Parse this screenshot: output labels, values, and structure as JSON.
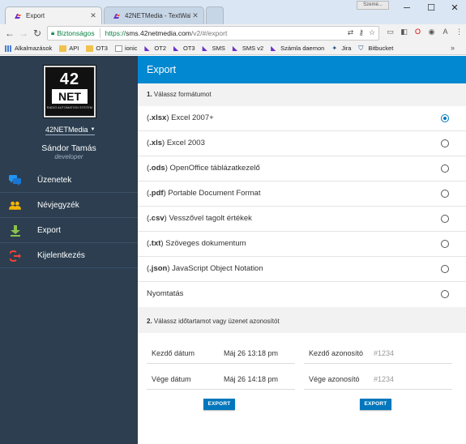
{
  "browser": {
    "tabs": [
      {
        "title": "Export",
        "active": true
      },
      {
        "title": "42NETMedia - TextWall",
        "active": false
      }
    ],
    "user_badge": "Szemé...",
    "url": {
      "secure_label": "Biztonságos",
      "scheme": "https://",
      "host": "sms.42netmedia.com",
      "path": "/v2/#/export"
    },
    "bookmarks": [
      {
        "label": "Alkalmazások",
        "icon": "apps-grid-icon"
      },
      {
        "label": "API",
        "icon": "folder-icon"
      },
      {
        "label": "OT3",
        "icon": "folder-icon"
      },
      {
        "label": "ionic",
        "icon": "page-icon"
      },
      {
        "label": "OT2",
        "icon": "42net-logo-icon"
      },
      {
        "label": "OT3",
        "icon": "42net-logo-icon"
      },
      {
        "label": "SMS",
        "icon": "42net-logo-icon"
      },
      {
        "label": "SMS v2",
        "icon": "42net-logo-icon"
      },
      {
        "label": "Számla daemon",
        "icon": "42net-logo-icon"
      },
      {
        "label": "Jira",
        "icon": "jira-icon"
      },
      {
        "label": "Bitbucket",
        "icon": "bitbucket-icon"
      }
    ]
  },
  "sidebar": {
    "logo": {
      "top": "42",
      "mid": "NET",
      "sub": "RADIO AUTOMATION SYSTEM"
    },
    "company": "42NETMedia",
    "user_name": "Sándor Tamás",
    "user_role": "developer",
    "menu": [
      {
        "label": "Üzenetek",
        "icon": "chat-icon",
        "color": "#2196f3"
      },
      {
        "label": "Névjegyzék",
        "icon": "contacts-icon",
        "color": "#f5b400"
      },
      {
        "label": "Export",
        "icon": "download-icon",
        "color": "#8bc34a"
      },
      {
        "label": "Kijelentkezés",
        "icon": "logout-icon",
        "color": "#f44336"
      }
    ]
  },
  "main": {
    "title": "Export",
    "step1": {
      "num": "1.",
      "label": "Válassz formátumot"
    },
    "formats": [
      {
        "ext": ".xlsx",
        "desc": "Excel 2007+",
        "selected": true
      },
      {
        "ext": ".xls",
        "desc": "Excel 2003",
        "selected": false
      },
      {
        "ext": ".ods",
        "desc": "OpenOffice táblázatkezelő",
        "selected": false
      },
      {
        "ext": ".pdf",
        "desc": "Portable Document Format",
        "selected": false
      },
      {
        "ext": ".csv",
        "desc": "Vesszővel tagolt értékek",
        "selected": false
      },
      {
        "ext": ".txt",
        "desc": "Szöveges dokumentum",
        "selected": false
      },
      {
        "ext": ".json",
        "desc": "JavaScript Object Notation",
        "selected": false
      },
      {
        "ext": "",
        "desc": "Nyomtatás",
        "selected": false
      }
    ],
    "step2": {
      "num": "2.",
      "label": "Válassz időtartamot vagy üzenet azonosítót"
    },
    "date_range": {
      "start_label": "Kezdő dátum",
      "start_value": "Máj 26 13:18 pm",
      "end_label": "Vége dátum",
      "end_value": "Máj 26 14:18 pm",
      "button": "EXPORT"
    },
    "id_range": {
      "start_label": "Kezdő azonosító",
      "start_placeholder": "#1234",
      "end_label": "Vége azonosító",
      "end_placeholder": "#1234",
      "button": "EXPORT"
    }
  }
}
